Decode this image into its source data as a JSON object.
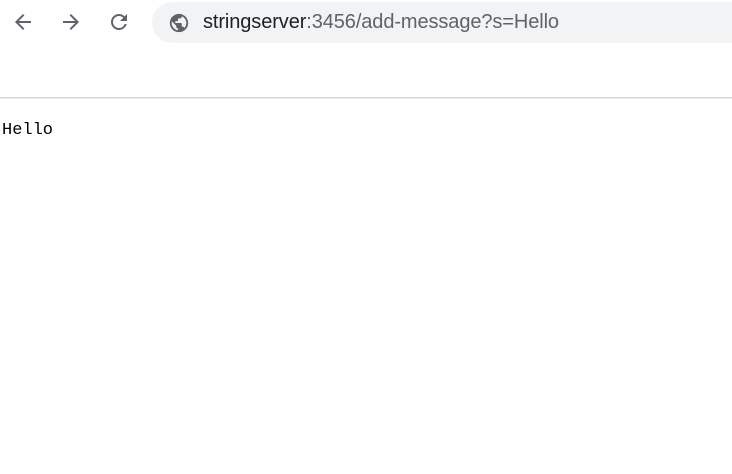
{
  "browser": {
    "nav": {
      "back_icon": "arrow-left-icon",
      "forward_icon": "arrow-right-icon",
      "reload_icon": "reload-icon"
    },
    "address_bar": {
      "site_info_icon": "globe-icon",
      "host": "stringserver",
      "rest": ":3456/add-message?s=Hello"
    }
  },
  "page": {
    "body_text": "Hello"
  },
  "colors": {
    "toolbar_icon": "#5f6368",
    "omnibox_bg": "#f1f3f4",
    "divider": "#d6d6d6"
  }
}
